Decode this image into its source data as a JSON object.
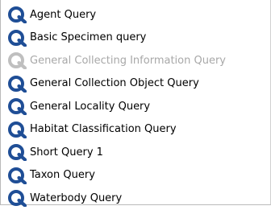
{
  "query_list": {
    "icon": "query-q-icon",
    "colors": {
      "icon_enabled": "#1f4e96",
      "icon_disabled": "#bfbfbf",
      "label_enabled": "#000000",
      "label_disabled": "#a8a8a8"
    },
    "items": [
      {
        "label": "Agent Query",
        "enabled": true
      },
      {
        "label": "Basic Specimen query",
        "enabled": true
      },
      {
        "label": "General Collecting Information Query",
        "enabled": false
      },
      {
        "label": "General Collection Object Query",
        "enabled": true
      },
      {
        "label": "General Locality Query",
        "enabled": true
      },
      {
        "label": "Habitat Classification Query",
        "enabled": true
      },
      {
        "label": "Short Query 1",
        "enabled": true
      },
      {
        "label": "Taxon Query",
        "enabled": true
      },
      {
        "label": "Waterbody Query",
        "enabled": true
      }
    ]
  }
}
